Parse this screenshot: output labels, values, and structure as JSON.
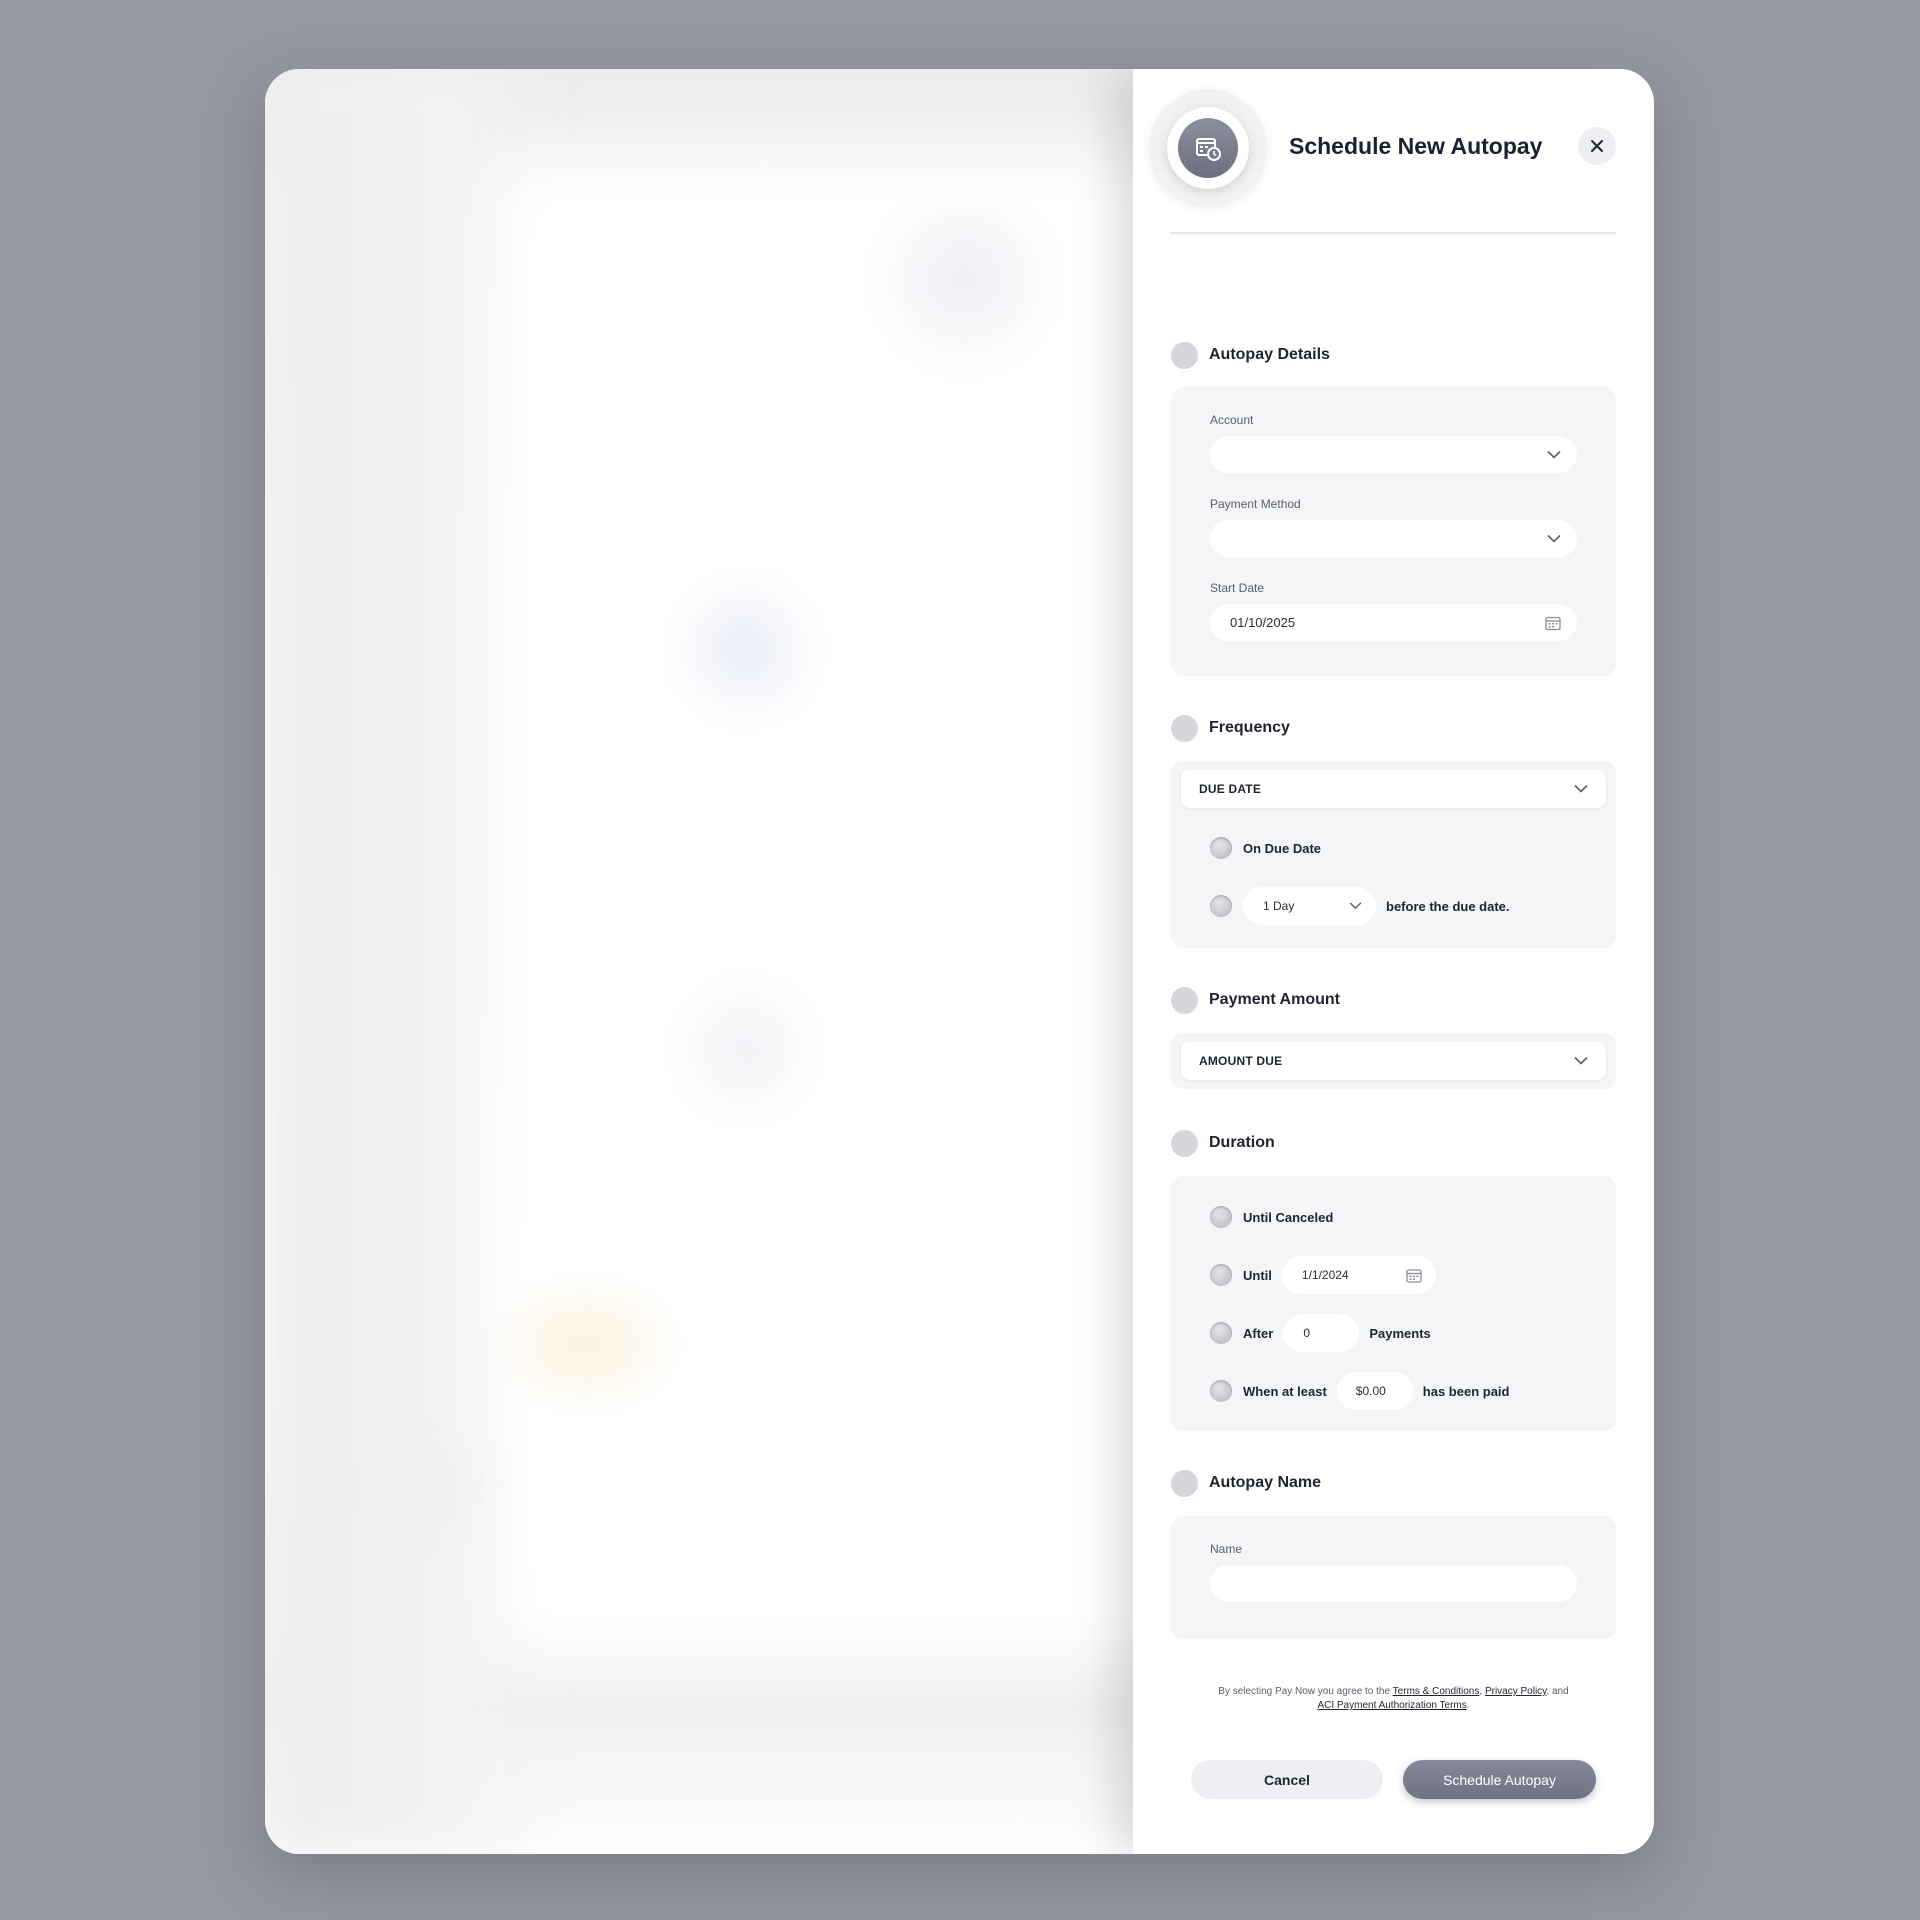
{
  "drawer": {
    "title": "Schedule New Autopay"
  },
  "autopay_details": {
    "title": "Autopay Details",
    "account_label": "Account",
    "account_value": "",
    "payment_method_label": "Payment Method",
    "payment_method_value": "",
    "start_date_label": "Start Date",
    "start_date_value": "01/10/2025"
  },
  "frequency": {
    "title": "Frequency",
    "selected": "DUE DATE",
    "option_on_due_date": "On Due Date",
    "days_before_value": "1 Day",
    "days_before_suffix": "before the due date."
  },
  "payment_amount": {
    "title": "Payment Amount",
    "selected": "AMOUNT DUE"
  },
  "duration": {
    "title": "Duration",
    "option_until_canceled": "Until Canceled",
    "option_until": "Until",
    "until_date_value": "1/1/2024",
    "option_after": "After",
    "after_count_value": "0",
    "after_suffix": "Payments",
    "option_when_at_least": "When at least",
    "at_least_amount_value": "$0.00",
    "at_least_suffix": "has been paid"
  },
  "autopay_name": {
    "title": "Autopay Name",
    "name_label": "Name",
    "name_value": ""
  },
  "legal": {
    "prefix": "By selecting Pay Now you agree to the ",
    "terms_link": "Terms & Conditions",
    "sep1": ", ",
    "privacy_link": "Privacy Policy",
    "sep2": ", and",
    "aci_link": "ACI Payment Authorization Terms",
    "suffix": "."
  },
  "actions": {
    "cancel_label": "Cancel",
    "submit_label": "Schedule Autopay"
  },
  "colors": {
    "backdrop": "#9698a1",
    "card_bg": "#f4f5f7",
    "primary_button": "#7d8090",
    "secondary_button": "#eeeff2"
  }
}
